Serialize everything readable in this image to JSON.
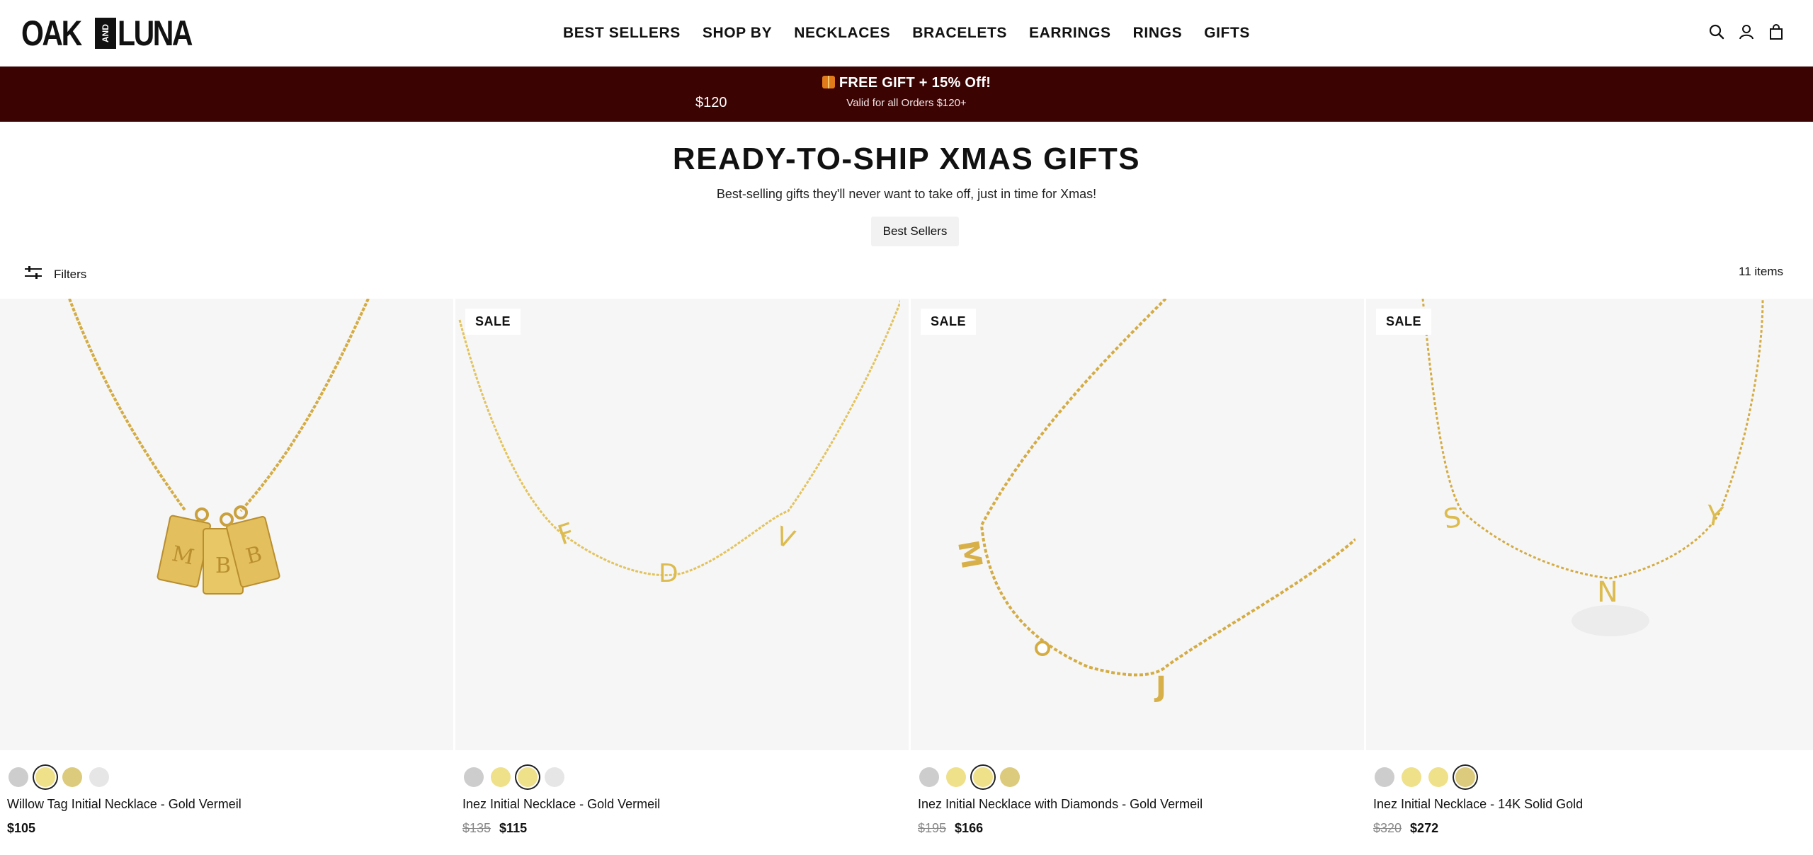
{
  "header": {
    "logo_left": "OAK",
    "logo_mark": "AND",
    "logo_right": "LUNA",
    "nav": [
      "BEST SELLERS",
      "SHOP BY",
      "NECKLACES",
      "BRACELETS",
      "EARRINGS",
      "RINGS",
      "GIFTS"
    ],
    "icons": [
      "search-icon",
      "account-icon",
      "bag-icon"
    ]
  },
  "promo": {
    "title": "FREE GIFT + 15% Off!",
    "subtitle": "Valid for all Orders $120+",
    "ticker": "$120"
  },
  "collection": {
    "title": "READY-TO-SHIP XMAS GIFTS",
    "subtitle": "Best-selling gifts they'll never want to take off, just in time for Xmas!",
    "chip": "Best Sellers"
  },
  "toolbar": {
    "filters_label": "Filters",
    "item_count": "11 items"
  },
  "products": [
    {
      "name": "Willow Tag Initial Necklace - Gold Vermeil",
      "badge": "",
      "price_old": "",
      "price": "$105",
      "swatches": [
        "#cdcdcd",
        "#efe08a",
        "#dccb7c",
        "#e6e6e6"
      ],
      "selected_swatch": 1
    },
    {
      "name": "Inez Initial Necklace - Gold Vermeil",
      "badge": "SALE",
      "price_old": "$135",
      "price": "$115",
      "swatches": [
        "#cdcdcd",
        "#efe08a",
        "#efe08a",
        "#e6e6e6"
      ],
      "selected_swatch": 2
    },
    {
      "name": "Inez Initial Necklace with Diamonds - Gold Vermeil",
      "badge": "SALE",
      "price_old": "$195",
      "price": "$166",
      "swatches": [
        "#cdcdcd",
        "#efe08a",
        "#efe08a",
        "#dccb7c"
      ],
      "selected_swatch": 2
    },
    {
      "name": "Inez Initial Necklace - 14K Solid Gold",
      "badge": "SALE",
      "price_old": "$320",
      "price": "$272",
      "swatches": [
        "#cdcdcd",
        "#efe08a",
        "#efe08a",
        "#dccb7c"
      ],
      "selected_swatch": 3
    }
  ],
  "colors": {
    "promo_bg": "#3c0303",
    "gold": "#d8b04a",
    "image_bg": "#f6f6f6"
  }
}
